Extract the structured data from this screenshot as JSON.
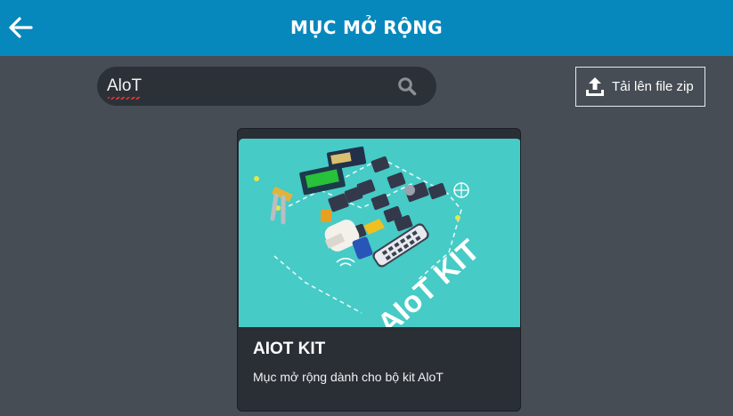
{
  "header": {
    "title": "MỤC MỞ RỘNG",
    "back_icon": "arrow-left-icon",
    "color": "#0788bd"
  },
  "search": {
    "value": "AloT",
    "icon": "search-icon"
  },
  "upload": {
    "label": "Tải lên file zip",
    "icon": "upload-icon"
  },
  "extensions": [
    {
      "title": "AIOT KIT",
      "image_text": "AIoT KIT",
      "description": "Mục mở rộng dành cho bộ kit AloT"
    }
  ],
  "colors": {
    "background": "#474d55",
    "card": "#2a2e35",
    "image_bg": "#46cbc6"
  }
}
